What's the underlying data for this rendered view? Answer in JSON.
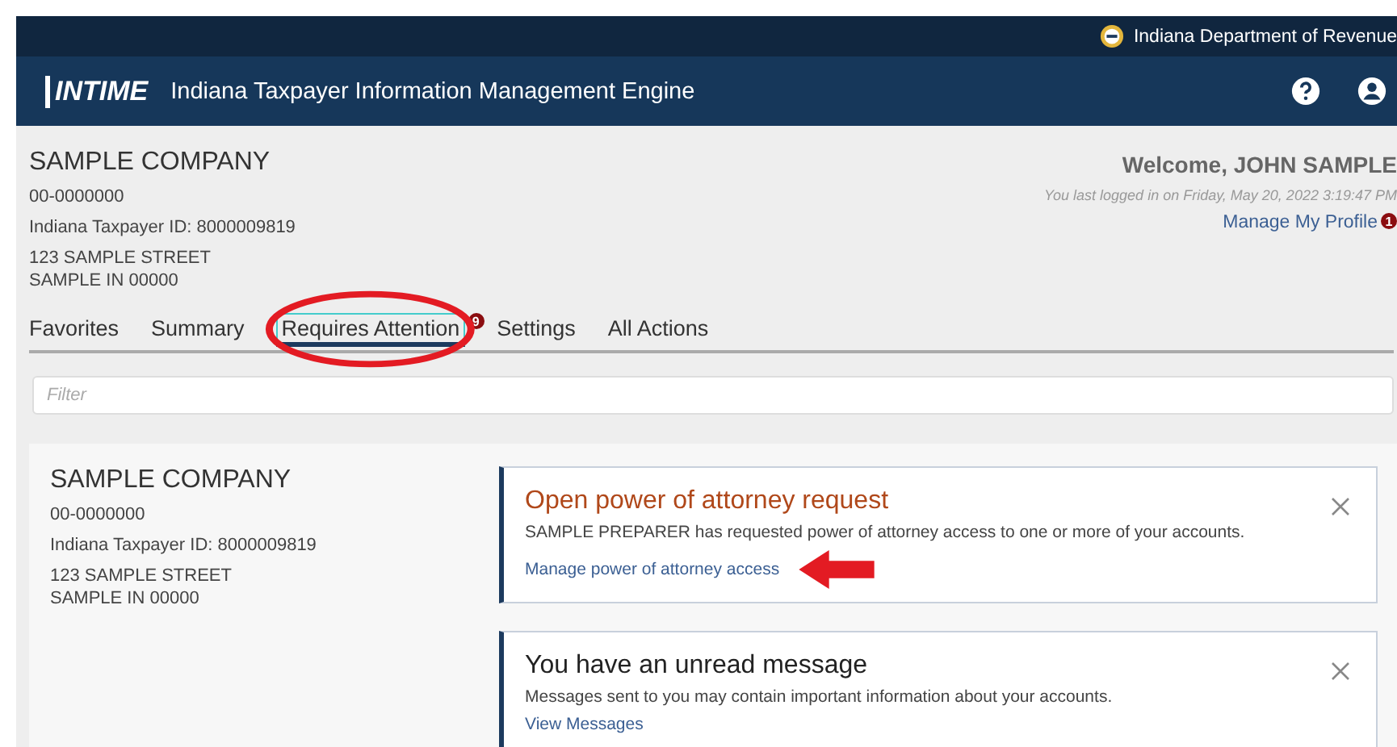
{
  "top_bar": {
    "agency": "Indiana Department of Revenue"
  },
  "header": {
    "logo": "INTIME",
    "title": "Indiana Taxpayer Information Management Engine"
  },
  "account": {
    "name": "SAMPLE COMPANY",
    "ein": "00-0000000",
    "taxpayer_id": "Indiana Taxpayer ID: 8000009819",
    "street": "123 SAMPLE STREET",
    "city": "SAMPLE IN 00000"
  },
  "user": {
    "welcome": "Welcome, JOHN SAMPLE",
    "last_login": "You last logged in on Friday, May 20, 2022 3:19:47 PM",
    "profile_link": "Manage My Profile",
    "profile_badge": "1"
  },
  "tabs": [
    {
      "label": "Favorites",
      "selected": false
    },
    {
      "label": "Summary",
      "selected": false
    },
    {
      "label": "Requires Attention",
      "selected": true,
      "badge": "9"
    },
    {
      "label": "Settings",
      "selected": false
    },
    {
      "label": "All Actions",
      "selected": false
    }
  ],
  "filter": {
    "placeholder": "Filter"
  },
  "panel": {
    "name": "SAMPLE COMPANY",
    "ein": "00-0000000",
    "taxpayer_id": "Indiana Taxpayer ID: 8000009819",
    "street": "123 SAMPLE STREET",
    "city": "SAMPLE IN 00000"
  },
  "alerts": [
    {
      "kind": "request",
      "title": "Open power of attorney request",
      "text": "SAMPLE PREPARER has requested power of attorney access to one or more of your accounts.",
      "link": "Manage power of attorney access"
    },
    {
      "kind": "message",
      "title": "You have an unread message",
      "text": "Messages sent to you may contain important information about your accounts.",
      "link": "View Messages"
    }
  ]
}
